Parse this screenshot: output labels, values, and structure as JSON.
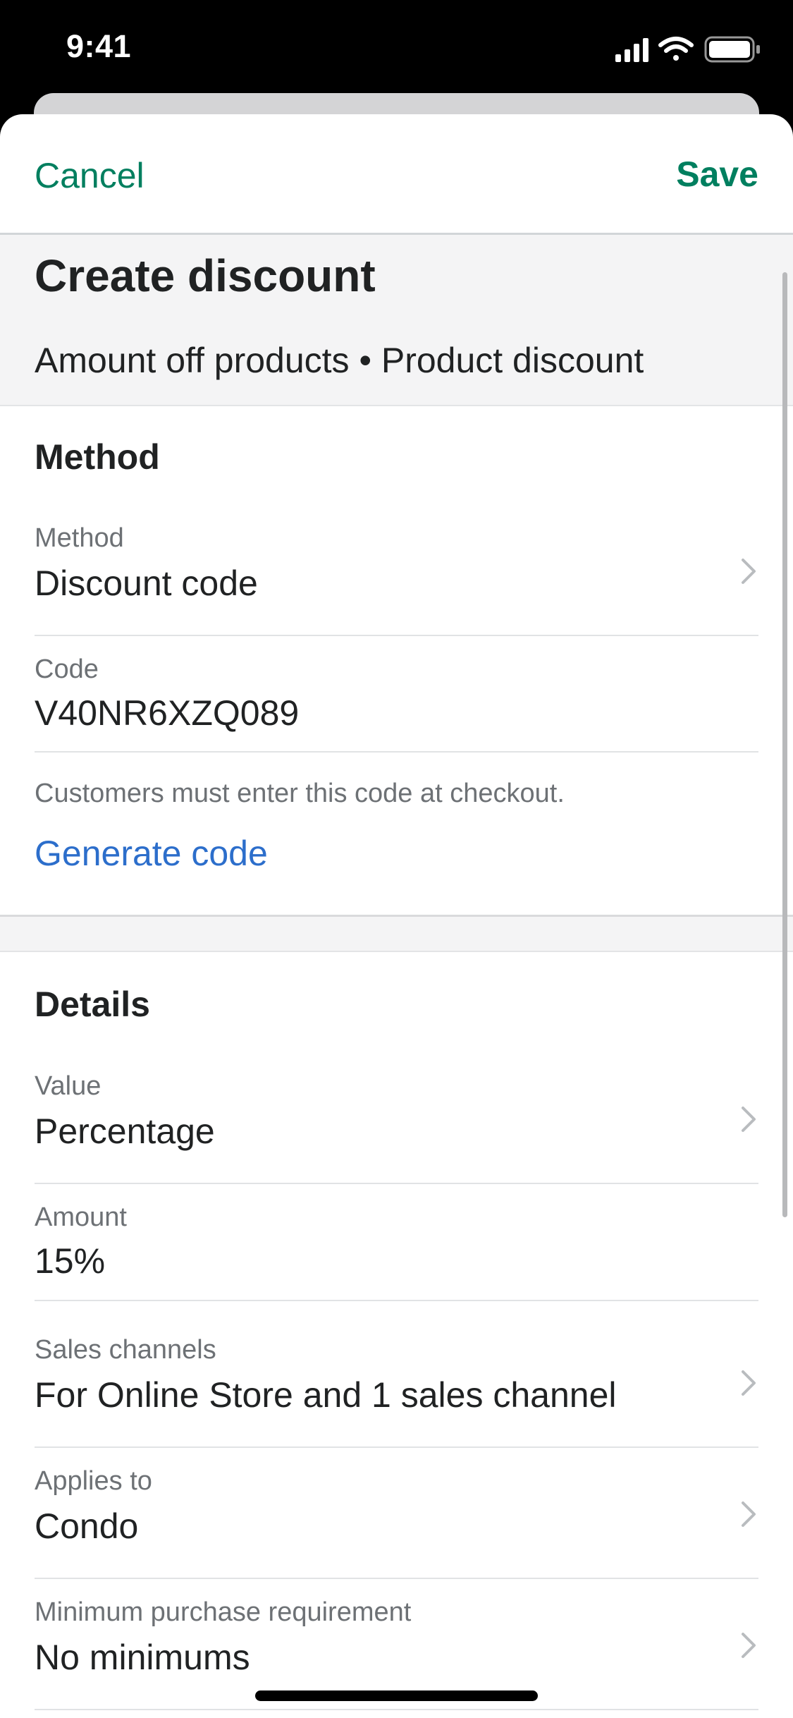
{
  "status_bar": {
    "time": "9:41",
    "icons": [
      "signal-icon",
      "wifi-icon",
      "battery-icon"
    ]
  },
  "nav": {
    "cancel_label": "Cancel",
    "save_label": "Save"
  },
  "header": {
    "title": "Create discount",
    "subtitle": "Amount off products • Product discount"
  },
  "method_section": {
    "title": "Method",
    "method": {
      "label": "Method",
      "value": "Discount code"
    },
    "code": {
      "label": "Code",
      "value": "V40NR6XZQ089"
    },
    "helper_text": "Customers must enter this code at checkout.",
    "generate_label": "Generate code"
  },
  "details_section": {
    "title": "Details",
    "value": {
      "label": "Value",
      "value": "Percentage"
    },
    "amount": {
      "label": "Amount",
      "value": "15%"
    },
    "sales_channels": {
      "label": "Sales channels",
      "value": "For Online Store and 1 sales channel"
    },
    "applies_to": {
      "label": "Applies to",
      "value": "Condo"
    },
    "minimum_purchase": {
      "label": "Minimum purchase requirement",
      "value": "No minimums"
    }
  },
  "colors": {
    "primary_green": "#007f5f",
    "link_blue": "#2c6ecb",
    "text": "#202223",
    "subdued_text": "#6d7175",
    "band_background": "#f4f4f5"
  }
}
